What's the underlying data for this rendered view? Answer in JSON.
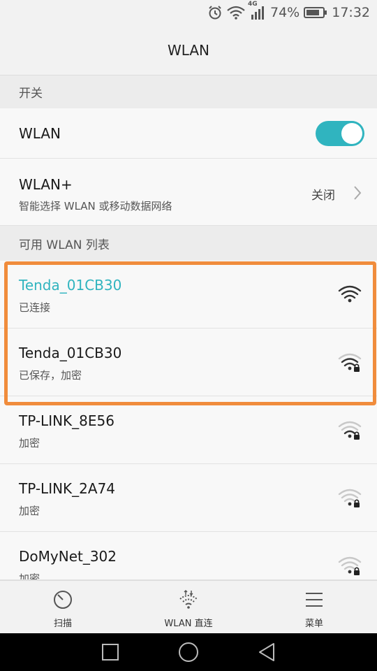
{
  "status_bar": {
    "network_type": "4G",
    "battery_percent": "74%",
    "time": "17:32",
    "icons": [
      "alarm-icon",
      "wifi-icon",
      "signal-icon",
      "battery-icon"
    ]
  },
  "title": "WLAN",
  "switch_section": {
    "header": "开关",
    "wlan_label": "WLAN",
    "wlan_enabled": true,
    "wlan_plus_label": "WLAN+",
    "wlan_plus_desc": "智能选择 WLAN 或移动数据网络",
    "wlan_plus_state": "关闭"
  },
  "networks_section": {
    "header": "可用 WLAN 列表",
    "networks": [
      {
        "ssid": "Tenda_01CB30",
        "status": "已连接",
        "connected": true,
        "secured": false,
        "signal": 4
      },
      {
        "ssid": "Tenda_01CB30",
        "status": "已保存，加密",
        "connected": false,
        "secured": true,
        "signal": 3
      },
      {
        "ssid": "TP-LINK_8E56",
        "status": "加密",
        "connected": false,
        "secured": true,
        "signal": 2
      },
      {
        "ssid": "TP-LINK_2A74",
        "status": "加密",
        "connected": false,
        "secured": true,
        "signal": 1
      },
      {
        "ssid": "DoMyNet_302",
        "status": "加密",
        "connected": false,
        "secured": true,
        "signal": 1
      }
    ]
  },
  "bottom_bar": {
    "scan_label": "扫描",
    "direct_label": "WLAN 直连",
    "menu_label": "菜单"
  },
  "colors": {
    "accent": "#30b4bf",
    "connected_text": "#30b4bf",
    "highlight_border": "#f08c3c"
  }
}
